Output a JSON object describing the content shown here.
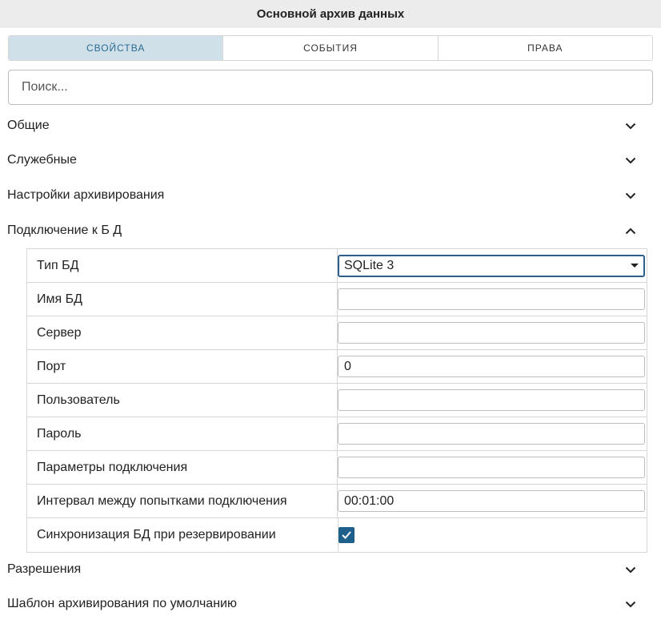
{
  "window": {
    "title": "Основной архив данных"
  },
  "tabs": [
    {
      "label": "СВОЙСТВА",
      "active": true
    },
    {
      "label": "СОБЫТИЯ",
      "active": false
    },
    {
      "label": "ПРАВА",
      "active": false
    }
  ],
  "search": {
    "placeholder": "Поиск...",
    "value": ""
  },
  "sections": {
    "general": {
      "label": "Общие",
      "expanded": false
    },
    "service": {
      "label": "Служебные",
      "expanded": false
    },
    "archiving": {
      "label": "Настройки архивирования",
      "expanded": false
    },
    "db_connection": {
      "label": "Подключение к Б Д",
      "expanded": true
    },
    "permissions": {
      "label": "Разрешения",
      "expanded": false
    },
    "default_template": {
      "label": "Шаблон архивирования по умолчанию",
      "expanded": false
    }
  },
  "db": {
    "type": {
      "label": "Тип БД",
      "value": "SQLite 3"
    },
    "name": {
      "label": "Имя БД",
      "value": ""
    },
    "server": {
      "label": "Сервер",
      "value": ""
    },
    "port": {
      "label": "Порт",
      "value": "0"
    },
    "user": {
      "label": "Пользователь",
      "value": ""
    },
    "password": {
      "label": "Пароль",
      "value": ""
    },
    "params": {
      "label": "Параметры подключения",
      "value": ""
    },
    "interval": {
      "label": "Интервал между попытками подключения",
      "value": "00:01:00"
    },
    "sync": {
      "label": "Синхронизация БД при резервировании",
      "checked": true
    }
  },
  "colors": {
    "accent": "#1f5f8b",
    "active_tab_bg": "#cfe0e9",
    "active_tab_text": "#2a6a93"
  },
  "icons": {
    "collapsed": "chevron-down-icon",
    "expanded": "chevron-up-icon",
    "checked": "checkmark-icon",
    "dropdown": "caret-down-icon"
  }
}
